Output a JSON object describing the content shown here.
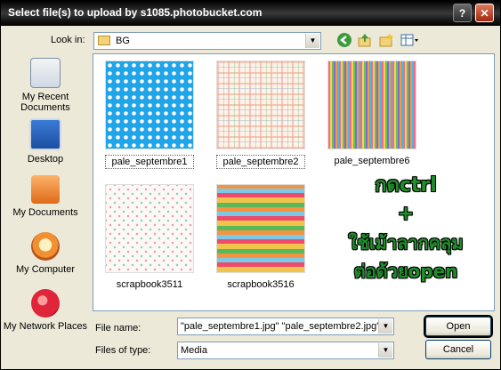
{
  "window": {
    "title": "Select file(s) to upload by s1085.photobucket.com",
    "help_glyph": "?",
    "close_glyph": "✕"
  },
  "lookin": {
    "label": "Look in:",
    "value": "BG"
  },
  "places": [
    {
      "label": "My Recent Documents",
      "icon": "recent-documents-icon"
    },
    {
      "label": "Desktop",
      "icon": "desktop-icon"
    },
    {
      "label": "My Documents",
      "icon": "my-documents-icon"
    },
    {
      "label": "My Computer",
      "icon": "my-computer-icon"
    },
    {
      "label": "My Network Places",
      "icon": "network-places-icon"
    }
  ],
  "files": [
    {
      "name": "pale_septembre1",
      "pattern": "polka-dots",
      "selected": true
    },
    {
      "name": "pale_septembre2",
      "pattern": "plaid",
      "selected": true
    },
    {
      "name": "pale_septembre6",
      "pattern": "stripes",
      "selected": false
    },
    {
      "name": "scrapbook3511",
      "pattern": "confetti",
      "selected": false
    },
    {
      "name": "scrapbook3516",
      "pattern": "horizontal-stripes",
      "selected": false
    }
  ],
  "filename": {
    "label": "File name:",
    "value": "\"pale_septembre1.jpg\" \"pale_septembre2.jpg\" \""
  },
  "filetype": {
    "label": "Files of type:",
    "value": "Media"
  },
  "buttons": {
    "open": "Open",
    "cancel": "Cancel"
  },
  "overlay_text": [
    "กดctrl",
    "+",
    "ใช้เม้าลากคลุม",
    "ต่อด้วยopen"
  ],
  "colors": {
    "overlay": "#1e8f2a",
    "selection_border": "#000000"
  }
}
